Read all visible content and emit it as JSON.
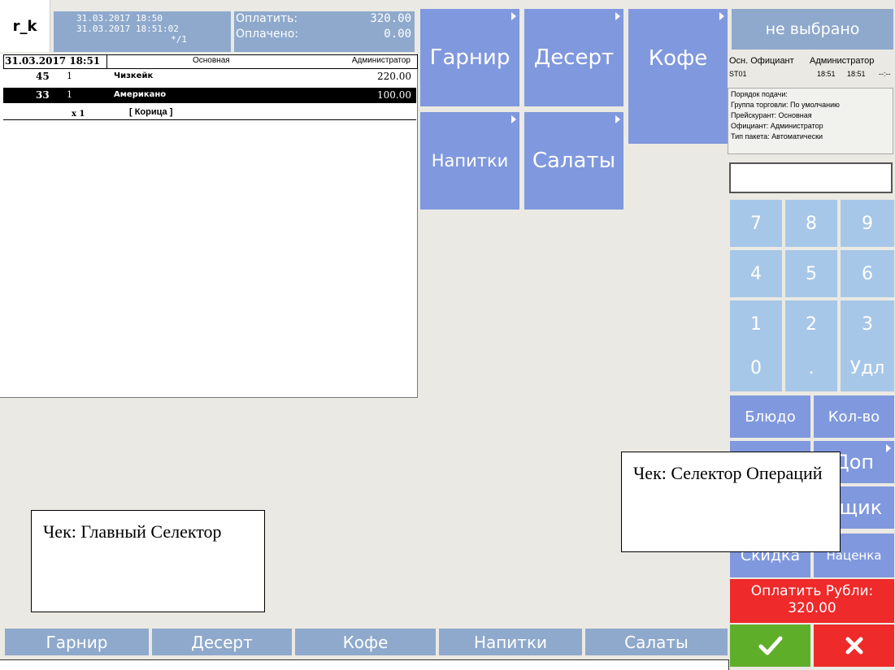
{
  "header": {
    "logo": "r_k",
    "date_open": "31.03.2017 18:50",
    "date_now": "31.03.2017 18:51:02",
    "guest_counter": "*/1",
    "to_pay_label": "Оплатить:",
    "to_pay_value": "320.00",
    "paid_label": "Оплачено:",
    "paid_value": "0.00"
  },
  "check": {
    "date": "31.03.2017 18:51",
    "menu": "Основная",
    "waiter": "Администратор",
    "items": [
      {
        "num": "45",
        "qty": "1",
        "name": "Чизкейк",
        "price": "220.00",
        "selected": false
      },
      {
        "num": "33",
        "qty": "1",
        "name": "Американо",
        "price": "100.00",
        "selected": true
      }
    ],
    "modifier": {
      "qty": "x 1",
      "name": "[ Корица ]"
    }
  },
  "categories": [
    {
      "label": "Гарнир"
    },
    {
      "label": "Десерт"
    },
    {
      "label": "Кофе"
    },
    {
      "label": "Напитки"
    },
    {
      "label": "Салаты"
    }
  ],
  "right_panel": {
    "not_selected": "не выбрано",
    "main_waiter_label": "Осн. Официант",
    "main_waiter_value": "Администратор",
    "station": "ST01",
    "time_open": "18:51",
    "time_now": "18:51",
    "time_extra": "--:--",
    "info": [
      "Порядок подачи:",
      "Группа торговли: По умолчанию",
      "Прейскурант: Основная",
      "Официант: Администратор",
      "Тип пакета: Автоматически"
    ]
  },
  "keypad": [
    "7",
    "8",
    "9",
    "4",
    "5",
    "6",
    "1",
    "2",
    "3",
    "0",
    ".",
    "Удл"
  ],
  "operations": {
    "dish": "Блюдо",
    "quantity": "Кол-во",
    "extra": "Доп",
    "box": "Ящик",
    "discount": "Скидка",
    "markup": "Наценка"
  },
  "pay_button": {
    "label": "Оплатить Рубли:",
    "amount": "320.00"
  },
  "bottom_tabs": [
    "Гарнир",
    "Десерт",
    "Кофе",
    "Напитки",
    "Салаты"
  ],
  "callouts": {
    "main_selector": "Чек: Главный Селектор",
    "ops_selector": "Чек: Селектор Операций"
  },
  "colors": {
    "tile_blue": "#8098dd",
    "header_blue": "#8ea9cc",
    "keypad_blue": "#a7c7e8",
    "pay_red": "#ee2a2a",
    "ok_green": "#5fae2a"
  }
}
